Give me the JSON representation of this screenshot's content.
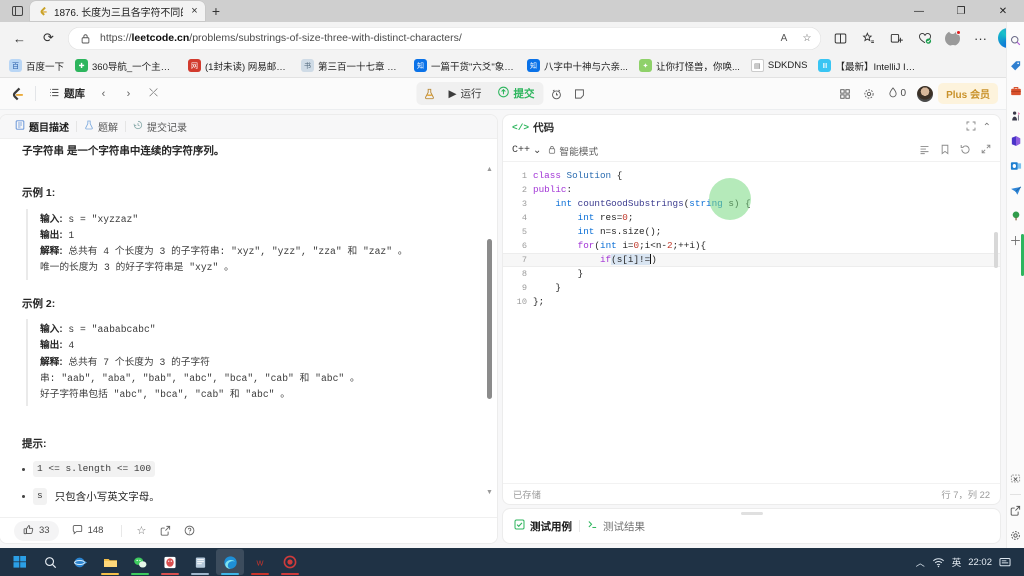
{
  "browser": {
    "tab": {
      "title": "1876. 长度为三且各字符不同的子",
      "favicon": "leetcode-icon",
      "close": "×"
    },
    "new_tab": "+",
    "window_controls": {
      "minimize": "—",
      "maximize": "❐",
      "close": "✕"
    },
    "nav": {
      "back": "←",
      "refresh": "⟳"
    },
    "omnibox": {
      "lock_icon": "lock-icon",
      "url_prefix": "https://",
      "url_domain": "leetcode.cn",
      "url_path": "/problems/substrings-of-size-three-with-distinct-characters/",
      "read_aloud": "A",
      "favorite": "☆"
    },
    "toolbar_icons": [
      "split-screen-icon",
      "favorites-icon",
      "collections-icon",
      "browser-essentials-icon",
      "profile-icon",
      "settings-more-icon",
      "copilot-icon"
    ],
    "bookmarks": [
      {
        "label": "百度一下",
        "icon": "baidu-icon",
        "color": "#3a7bd5"
      },
      {
        "label": "360导航_一个主页...",
        "icon": "360-icon",
        "color": "#2db55d"
      },
      {
        "label": "(1封未读) 网易邮箱...",
        "icon": "netease-icon",
        "color": "#d23b2e"
      },
      {
        "label": "第三百一十七章 猝...",
        "icon": "book-icon",
        "color": "#8fa3b8"
      },
      {
        "label": "一篇干货\"六爻\"象法...",
        "icon": "zhihu-icon",
        "color": "#0a72e8"
      },
      {
        "label": "八字中十神与六亲...",
        "icon": "zhihu-icon",
        "color": "#0a72e8"
      },
      {
        "label": "让你打怪兽，你唤...",
        "icon": "novel-icon",
        "color": "#7ec95a"
      },
      {
        "label": "SDKDNS",
        "icon": "page-icon",
        "color": "#ffffff"
      },
      {
        "label": "【最新】IntelliJ IDE...",
        "icon": "idea-icon",
        "color": "#39c5f3"
      }
    ],
    "bookmarks_overflow": "›",
    "sidebar_icons": [
      "search-icon",
      "shopping-tag-icon",
      "tools-icon",
      "games-icon",
      "microsoft365-icon",
      "outlook-icon",
      "send-icon",
      "tree-icon",
      "add-icon",
      "drop-icon",
      "split-icon",
      "settings-icon"
    ]
  },
  "leetcode": {
    "header": {
      "logo": "leetcode-logo",
      "problem_list_label": "题库",
      "prev": "‹",
      "next": "›",
      "shuffle": "⤫",
      "flask_icon": "flask-icon",
      "run_label": "运行",
      "submit_label": "提交",
      "timer_icon": "timer-icon",
      "note_icon": "note-icon",
      "grid_icon": "grid-icon",
      "gear_icon": "gear-icon",
      "coins_count": "0",
      "coins_icon": "coin-icon",
      "avatar": "user-avatar",
      "plus_label": "Plus 会员"
    },
    "left_panel": {
      "tabs": [
        {
          "label": "题目描述",
          "icon": "description-icon",
          "active": true
        },
        {
          "label": "题解",
          "icon": "solution-icon",
          "active": false
        },
        {
          "label": "提交记录",
          "icon": "history-icon",
          "active": false
        }
      ],
      "intro": "子字符串 是一个字符串中连续的字符序列。",
      "examples": [
        {
          "title": "示例 1:",
          "lines": [
            {
              "label": "输入:",
              "text": " s = \"xyzzaz\""
            },
            {
              "label": "输出:",
              "text": " 1"
            },
            {
              "label": "解释:",
              "text": " 总共有 4 个长度为 3 的子字符串: \"xyz\", \"yzz\", \"zza\" 和 \"zaz\" 。"
            },
            {
              "label": "",
              "text": "唯一的长度为 3 的好子字符串是 \"xyz\" 。"
            }
          ]
        },
        {
          "title": "示例 2:",
          "lines": [
            {
              "label": "输入:",
              "text": " s = \"aababcabc\""
            },
            {
              "label": "输出:",
              "text": " 4"
            },
            {
              "label": "解释:",
              "text": " 总共有 7 个长度为 3 的子字符"
            },
            {
              "label": "",
              "text": "串: \"aab\", \"aba\", \"bab\", \"abc\", \"bca\", \"cab\" 和 \"abc\" 。"
            },
            {
              "label": "",
              "text": "好子字符串包括 \"abc\", \"bca\", \"cab\" 和 \"abc\" 。"
            }
          ]
        }
      ],
      "hints_title": "提示:",
      "hints": [
        {
          "code": "1 <= s.length <= 100",
          "text": ""
        },
        {
          "code": "s",
          "text": " 只包含小写英文字母。"
        }
      ],
      "footer": {
        "likes": "33",
        "likes_icon": "thumbs-up-icon",
        "comments": "148",
        "comments_icon": "comment-icon",
        "star_icon": "star-icon",
        "share_icon": "share-icon",
        "help_icon": "help-icon"
      }
    },
    "code_panel": {
      "title": "代码",
      "title_tag": "</>",
      "expand_icon": "fullscreen-icon",
      "collapse_icon": "chevron-up-icon",
      "language": "C++",
      "language_caret": "⌄",
      "mode_lock_icon": "lock-icon",
      "mode_label": "智能模式",
      "format_icon": "format-icon",
      "bookmark_icon": "bookmark-icon",
      "reset_icon": "reset-icon",
      "expand2_icon": "expand-icon",
      "lines": [
        {
          "n": "1",
          "text": "class Solution {"
        },
        {
          "n": "2",
          "text": "public:"
        },
        {
          "n": "3",
          "text": "    int countGoodSubstrings(string s) {"
        },
        {
          "n": "4",
          "text": "        int res=0;"
        },
        {
          "n": "5",
          "text": "        int n=s.size();"
        },
        {
          "n": "6",
          "text": "        for(int i=0;i<n-2;++i){"
        },
        {
          "n": "7",
          "text": "            if(s[i]!=)"
        },
        {
          "n": "8",
          "text": "        }"
        },
        {
          "n": "9",
          "text": "    }"
        },
        {
          "n": "10",
          "text": "};"
        }
      ],
      "status_left": "已存储",
      "status_right": "行 7，列 22"
    },
    "test_panel": {
      "tabs": [
        {
          "label": "测试用例",
          "icon": "checkbox-icon",
          "active": true
        },
        {
          "label": "测试结果",
          "icon": "terminal-icon",
          "active": false
        }
      ]
    }
  },
  "taskbar": {
    "items": [
      {
        "name": "start-button",
        "icon": "windows-logo",
        "color": "#2b9fe6"
      },
      {
        "name": "search",
        "icon": "search-icon",
        "color": "#ffffff"
      },
      {
        "name": "internet-explorer",
        "icon": "ie-icon",
        "color": "#2b84d0"
      },
      {
        "name": "file-explorer",
        "icon": "folder-icon",
        "color": "#f5c04a"
      },
      {
        "name": "wechat",
        "icon": "wechat-icon",
        "color": "#3ecb5f"
      },
      {
        "name": "qq",
        "icon": "qq-icon",
        "color": "#d94f4f"
      },
      {
        "name": "notes",
        "icon": "notes-icon",
        "color": "#9fb6cc"
      },
      {
        "name": "edge",
        "icon": "edge-icon",
        "color": "#1e8fd6"
      },
      {
        "name": "wps",
        "icon": "wps-icon",
        "color": "#c9342b"
      },
      {
        "name": "recorder",
        "icon": "recorder-icon",
        "color": "#cf3b3b"
      }
    ],
    "tray": {
      "chevron": "︿",
      "network_icon": "wifi-icon",
      "ime": "英",
      "clock": "22:02",
      "notifications_icon": "notification-icon"
    }
  }
}
